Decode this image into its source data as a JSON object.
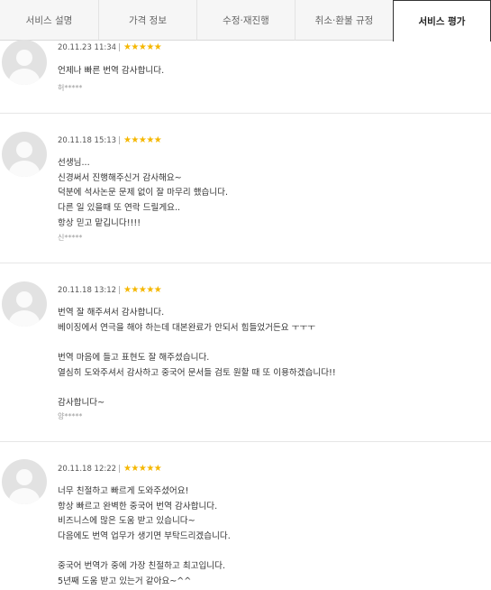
{
  "tabs": [
    {
      "label": "서비스 설명"
    },
    {
      "label": "가격 정보"
    },
    {
      "label": "수정·재진행"
    },
    {
      "label": "취소·환불 규정"
    },
    {
      "label": "서비스 평가"
    }
  ],
  "colors": {
    "star": "#f5b700",
    "avatar_bg": "#e2e2e2"
  },
  "stars_glyph": "★★★★★",
  "reviews": [
    {
      "date": "20.11.23 11:34",
      "rating": 5,
      "lines": [
        "언제나 빠른 번역 감사합니다."
      ],
      "author": "허*****"
    },
    {
      "date": "20.11.18 15:13",
      "rating": 5,
      "lines": [
        "선생님...",
        "신경써서 진행해주신거 감사해요~",
        "덕분에 석사논문 문제 없이 잘 마무리 했습니다.",
        "다른 일 있을때 또 연락 드릴게요..",
        "항상 믿고 맡깁니다!!!!"
      ],
      "author": "신*****"
    },
    {
      "date": "20.11.18 13:12",
      "rating": 5,
      "lines": [
        "번역 잘 해주셔서 감사합니다.",
        "베이징에서 연극을 해야 하는데 대본완료가 안되서 힘들었거든요 ㅜㅜㅜ",
        "",
        "번역 마음에 들고 표현도 잘 해주셨습니다.",
        "열심히 도와주셔서 감사하고 중국어 문서들 검토 원할 때 또 이용하겠습니다!!",
        "",
        "감사합니다~"
      ],
      "author": "양*****"
    },
    {
      "date": "20.11.18 12:22",
      "rating": 5,
      "lines": [
        "너무 친절하고 빠르게 도와주셨어요!",
        "항상 빠르고 완벽한 중국어 번역 감사합니다.",
        "비즈니스에 많은 도움 받고 있습니다~",
        "다음에도 번역 업무가 생기면 부탁드리겠습니다.",
        "",
        "중국어 번역가 중에 가장 친절하고 최고입니다.",
        "5년째 도움 받고 있는거 같아요~^^"
      ],
      "author": ""
    }
  ]
}
